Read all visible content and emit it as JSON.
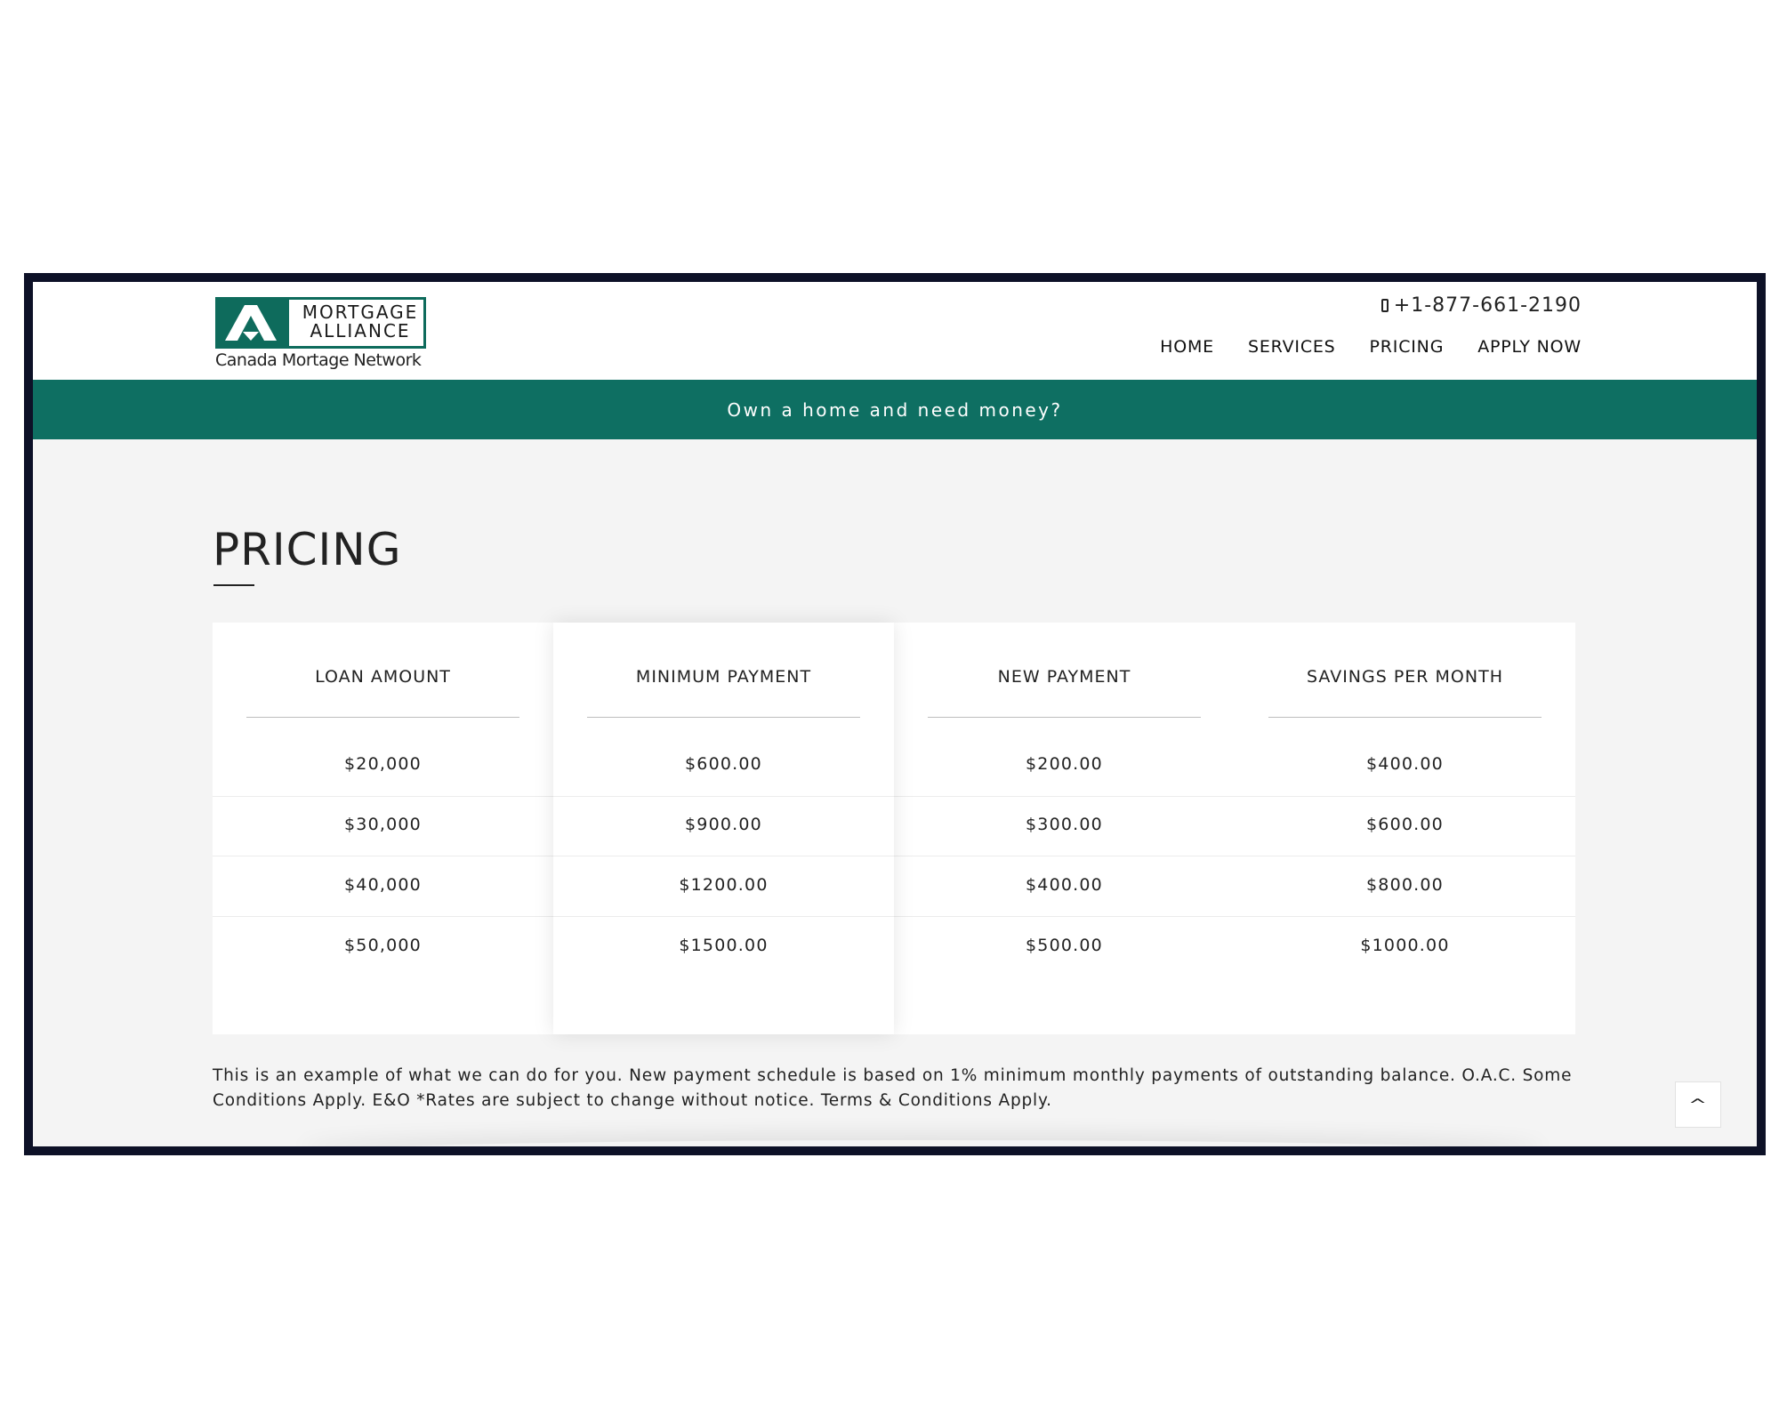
{
  "header": {
    "logo": {
      "line1": "MORTGAGE",
      "line2": "ALLIANCE",
      "subtitle": "Canada Mortage Network"
    },
    "phone": "+1-877-661-2190",
    "nav": [
      "HOME",
      "SERVICES",
      "PRICING",
      "APPLY NOW"
    ]
  },
  "banner": {
    "text": "Own a home and need money?"
  },
  "main": {
    "title": "PRICING",
    "table": {
      "columns": [
        "LOAN AMOUNT",
        "MINIMUM PAYMENT",
        "NEW PAYMENT",
        "SAVINGS PER MONTH"
      ],
      "rows": [
        [
          "$20,000",
          "$600.00",
          "$200.00",
          "$400.00"
        ],
        [
          "$30,000",
          "$900.00",
          "$300.00",
          "$600.00"
        ],
        [
          "$40,000",
          "$1200.00",
          "$400.00",
          "$800.00"
        ],
        [
          "$50,000",
          "$1500.00",
          "$500.00",
          "$1000.00"
        ]
      ]
    },
    "disclaimer": "This is an example of what we can do for you. New payment schedule is based on 1% minimum monthly payments of outstanding balance. O.A.C. Some Conditions Apply. E&O *Rates are subject to change without notice. Terms & Conditions Apply."
  },
  "icons": {
    "phone": "mobile-phone-icon",
    "scroll_top": "chevron-up-icon"
  },
  "colors": {
    "brand": "#0e6f62",
    "frame": "#0d1127",
    "background": "#f4f4f4"
  }
}
